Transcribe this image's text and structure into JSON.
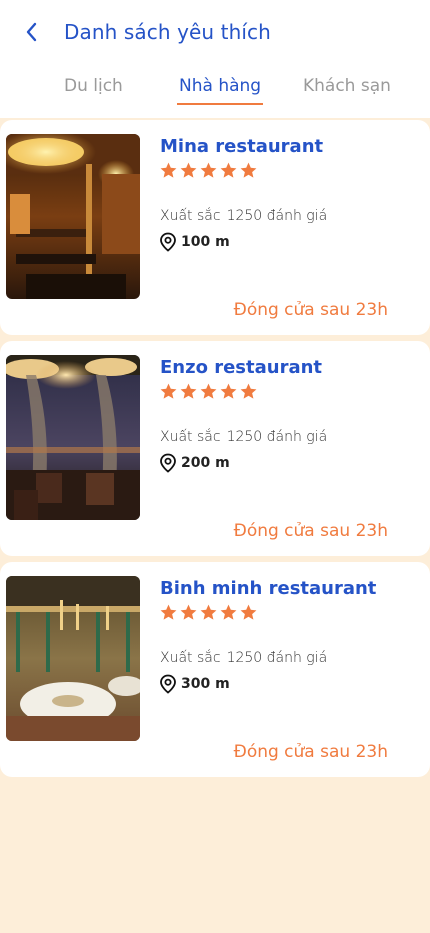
{
  "header": {
    "title": "Danh sách yêu thích"
  },
  "tabs": [
    {
      "label": "Du lịch",
      "active": false
    },
    {
      "label": "Nhà hàng",
      "active": true
    },
    {
      "label": "Khách sạn",
      "active": false
    }
  ],
  "restaurants": [
    {
      "name": "Mina restaurant",
      "stars": 5,
      "rating_label": "Xuất sắc",
      "reviews": "1250 đánh giá",
      "distance": "100 m",
      "closing": "Đóng cửa sau 23h"
    },
    {
      "name": "Enzo restaurant",
      "stars": 5,
      "rating_label": "Xuất sắc",
      "reviews": "1250 đánh giá",
      "distance": "200 m",
      "closing": "Đóng cửa sau 23h"
    },
    {
      "name": "Binh minh restaurant",
      "stars": 5,
      "rating_label": "Xuất sắc",
      "reviews": "1250 đánh giá",
      "distance": "300 m",
      "closing": "Đóng cửa sau 23h"
    }
  ],
  "colors": {
    "primary": "#2553c7",
    "accent": "#f07b3f",
    "background": "#fdeed9",
    "inactive_tab": "#9a9a9a"
  },
  "icons": {
    "back": "chevron-left-icon",
    "star": "star-icon",
    "location": "location-pin-icon"
  }
}
